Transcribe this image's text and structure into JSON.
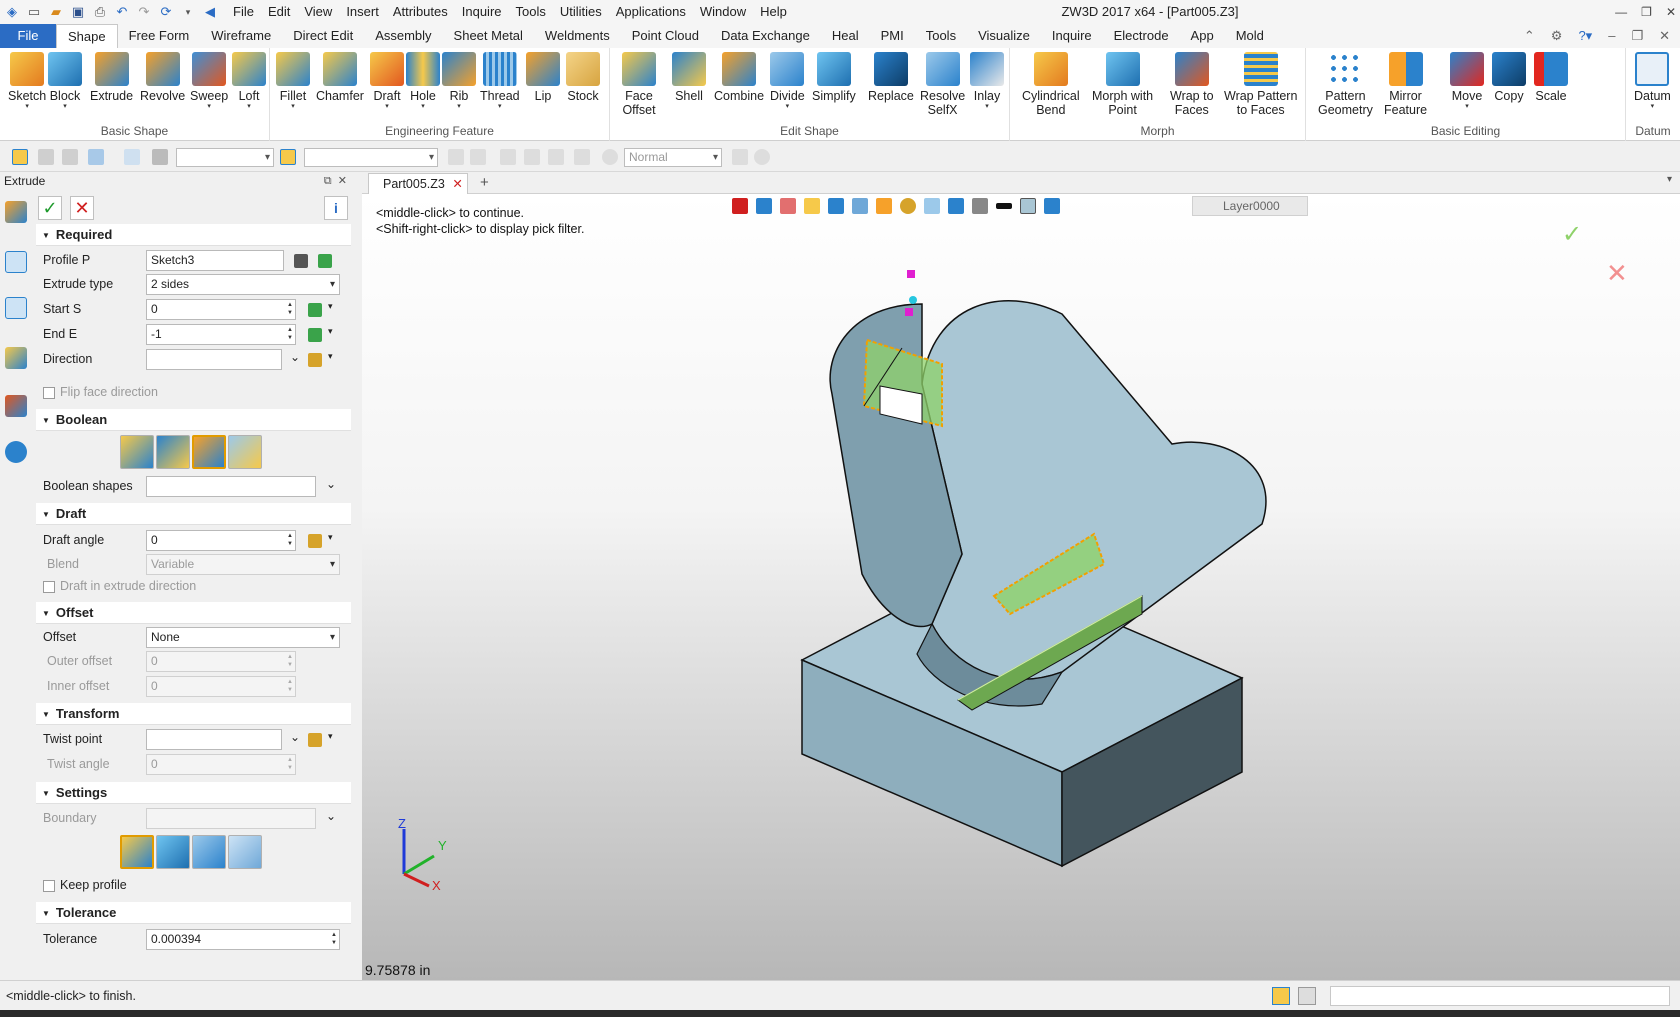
{
  "app": {
    "title": "ZW3D 2017  x64 - [Part005.Z3]",
    "menu": [
      "File",
      "Edit",
      "View",
      "Insert",
      "Attributes",
      "Inquire",
      "Tools",
      "Utilities",
      "Applications",
      "Window",
      "Help"
    ]
  },
  "ribbon_tabs": {
    "file": "File",
    "tabs": [
      "Shape",
      "Free Form",
      "Wireframe",
      "Direct Edit",
      "Assembly",
      "Sheet Metal",
      "Weldments",
      "Point Cloud",
      "Data Exchange",
      "Heal",
      "PMI",
      "Tools",
      "Visualize",
      "Inquire",
      "Electrode",
      "App",
      "Mold"
    ],
    "active": "Shape"
  },
  "ribbon": {
    "groups": {
      "basic_shape": "Basic Shape",
      "engineering_feature": "Engineering Feature",
      "edit_shape": "Edit Shape",
      "morph": "Morph",
      "basic_editing": "Basic Editing",
      "datum": "Datum"
    },
    "buttons": {
      "sketch": "Sketch",
      "block": "Block",
      "extrude": "Extrude",
      "revolve": "Revolve",
      "sweep": "Sweep",
      "loft": "Loft",
      "fillet": "Fillet",
      "chamfer": "Chamfer",
      "draft": "Draft",
      "hole": "Hole",
      "rib": "Rib",
      "thread": "Thread",
      "lip": "Lip",
      "stock": "Stock",
      "face_offset_1": "Face",
      "face_offset_2": "Offset",
      "shell": "Shell",
      "combine": "Combine",
      "divide": "Divide",
      "simplify": "Simplify",
      "replace": "Replace",
      "resolve_1": "Resolve",
      "resolve_2": "SelfX",
      "inlay": "Inlay",
      "cyl_1": "Cylindrical",
      "cyl_2": "Bend",
      "morph_1": "Morph with",
      "morph_2": "Point",
      "wrap_1": "Wrap to",
      "wrap_2": "Faces",
      "wrappat_1": "Wrap Pattern",
      "wrappat_2": "to Faces",
      "pattern_1": "Pattern",
      "pattern_2": "Geometry",
      "mirror_1": "Mirror",
      "mirror_2": "Feature",
      "move": "Move",
      "copy": "Copy",
      "scale": "Scale",
      "datum": "Datum"
    }
  },
  "toolbar2": {
    "mode": "Normal"
  },
  "panel": {
    "title": "Extrude",
    "sections": {
      "required": "Required",
      "boolean": "Boolean",
      "draft": "Draft",
      "offset": "Offset",
      "transform": "Transform",
      "settings": "Settings",
      "tolerance": "Tolerance"
    },
    "fields": {
      "profile_label": "Profile P",
      "profile_value": "Sketch3",
      "extrude_type_label": "Extrude type",
      "extrude_type_value": "2 sides",
      "start_label": "Start S",
      "start_value": "0",
      "end_label": "End E",
      "end_value": "-1",
      "direction_label": "Direction",
      "direction_value": "",
      "flip_label": "Flip face direction",
      "boolean_shapes_label": "Boolean shapes",
      "boolean_shapes_value": "",
      "draft_angle_label": "Draft angle",
      "draft_angle_value": "0",
      "blend_label": "Blend",
      "blend_value": "Variable",
      "draft_in_extrude_label": "Draft in extrude direction",
      "offset_label": "Offset",
      "offset_value": "None",
      "outer_offset_label": "Outer offset",
      "outer_offset_value": "0",
      "inner_offset_label": "Inner offset",
      "inner_offset_value": "0",
      "twist_point_label": "Twist point",
      "twist_point_value": "",
      "twist_angle_label": "Twist angle",
      "twist_angle_value": "0",
      "boundary_label": "Boundary",
      "boundary_value": "",
      "keep_profile_label": "Keep profile",
      "tolerance_label": "Tolerance",
      "tolerance_value": "0.000394"
    }
  },
  "document": {
    "tab": "Part005.Z3"
  },
  "viewport": {
    "hint1": "<middle-click> to continue.",
    "hint2": "<Shift-right-click> to display pick filter.",
    "layer": "Layer0000",
    "scale": "9.75878 in",
    "axes": {
      "x": "X",
      "y": "Y",
      "z": "Z"
    }
  },
  "status": {
    "text": "<middle-click> to finish."
  },
  "colors": {
    "accent": "#2b6cc4",
    "part": "#a9c6d4",
    "part_side": "#6d8c9b",
    "part_dark": "#44555d",
    "selection": "#f2a000",
    "preview": "#8fd26a"
  }
}
